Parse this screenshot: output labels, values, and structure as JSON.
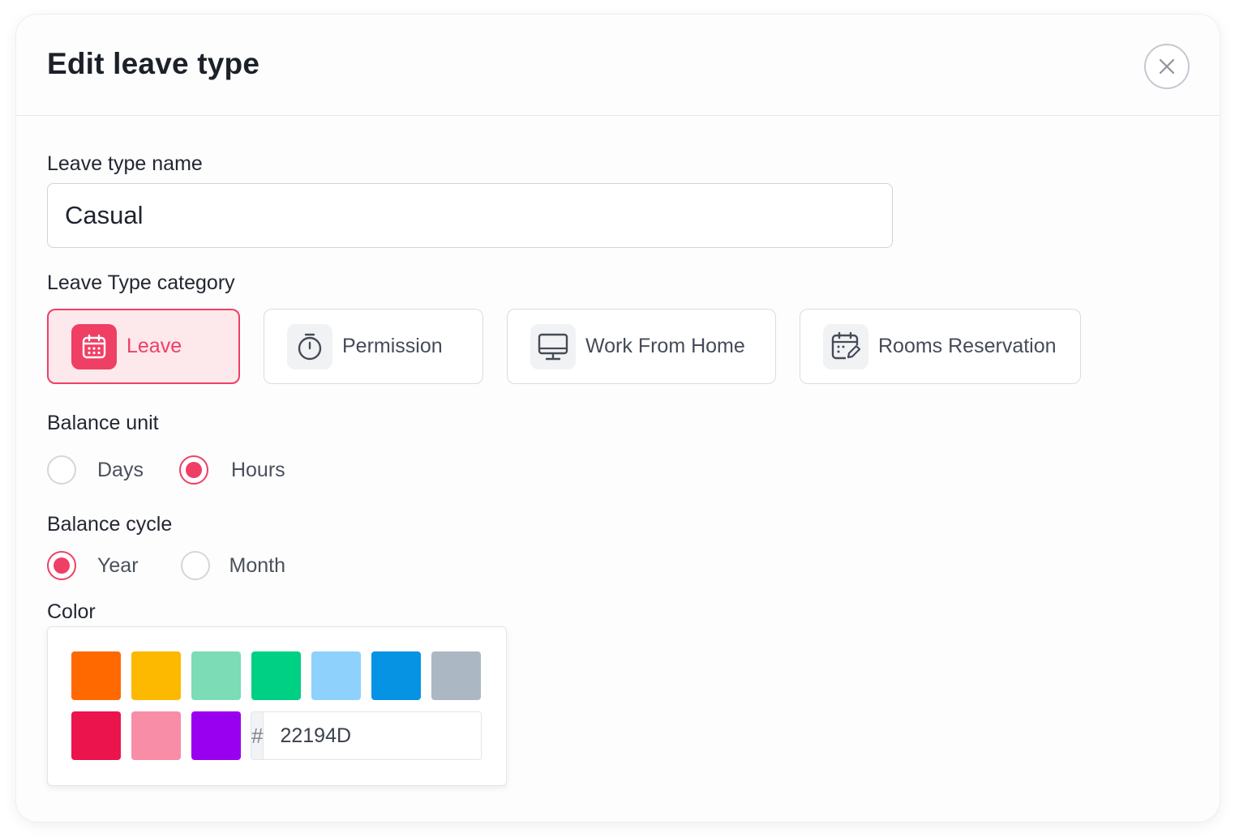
{
  "modal": {
    "title": "Edit leave type"
  },
  "name_field": {
    "label": "Leave type name",
    "value": "Casual"
  },
  "category": {
    "label": "Leave Type category",
    "options": [
      {
        "label": "Leave",
        "icon": "calendar-icon",
        "selected": true
      },
      {
        "label": "Permission",
        "icon": "stopwatch-icon",
        "selected": false
      },
      {
        "label": "Work From Home",
        "icon": "monitor-icon",
        "selected": false
      },
      {
        "label": "Rooms Reservation",
        "icon": "calendar-edit-icon",
        "selected": false
      }
    ]
  },
  "balance_unit": {
    "label": "Balance unit",
    "options": [
      {
        "label": "Days",
        "selected": false
      },
      {
        "label": "Hours",
        "selected": true
      }
    ]
  },
  "balance_cycle": {
    "label": "Balance cycle",
    "options": [
      {
        "label": "Year",
        "selected": true
      },
      {
        "label": "Month",
        "selected": false
      }
    ]
  },
  "color": {
    "label": "Color",
    "swatches": [
      "#FF6900",
      "#FCB900",
      "#7BDCB5",
      "#00D084",
      "#8ED1FC",
      "#0693E3",
      "#ABB8C3",
      "#EB144C",
      "#F78DA7",
      "#9900EF"
    ],
    "hex_prefix": "#",
    "hex_value": "22194D"
  },
  "theme": {
    "accent": "#EF3F64",
    "accent_bg": "#FDE8EC"
  }
}
